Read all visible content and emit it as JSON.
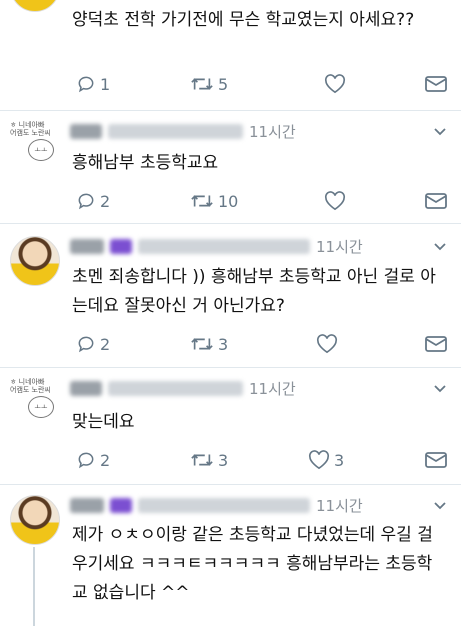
{
  "tweets": [
    {
      "text": "양덕초 전학 가기전에 무슨 학교였는지 아세요??",
      "time": "",
      "replies": "1",
      "retweets": "5",
      "likes": ""
    },
    {
      "text": "흥해남부 초등학교요",
      "time": "11시간",
      "replies": "2",
      "retweets": "10",
      "likes": "",
      "avatar_text": "ㅎ 니네아빠 \n어캠도 노란씨"
    },
    {
      "text": "초멘 죄송합니다 )) 흥해남부 초등학교 아닌 걸로 아는데요 잘못아신 거 아닌가요?",
      "time": "11시간",
      "replies": "2",
      "retweets": "3",
      "likes": ""
    },
    {
      "text": "맞는데요",
      "time": "11시간",
      "replies": "2",
      "retweets": "3",
      "likes": "3",
      "avatar_text": "ㅎ 니네아빠 \n어캠도 노란씨"
    },
    {
      "text": "제가 ㅇㅊㅇ이랑 같은 초등학교 다녔었는데 우길 걸 우기세요 ㅋㅋㅋㅌㅋㅋㅋㅋㅋ 흥해남부라는 초등학교 없습니다 ^^",
      "time": "11시간",
      "replies": "",
      "retweets": "",
      "likes": ""
    }
  ],
  "colors": {
    "text": "#111111",
    "meta": "#657786",
    "divider": "#e1e8ed",
    "thread": "#ccd6dd"
  },
  "icons": [
    "reply-icon",
    "retweet-icon",
    "like-icon",
    "dm-icon",
    "chevron-down-icon"
  ]
}
